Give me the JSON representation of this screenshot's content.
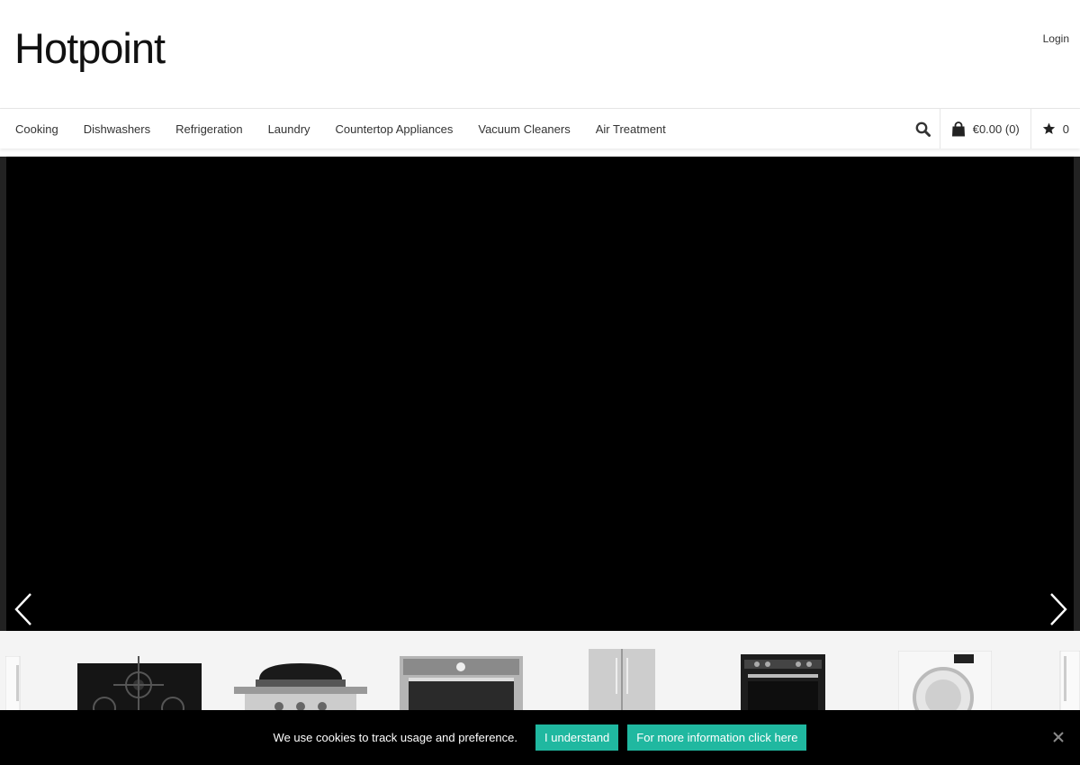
{
  "header": {
    "logo_text": "Hotpoint",
    "login_label": "Login"
  },
  "nav": {
    "items": [
      {
        "label": "Cooking"
      },
      {
        "label": "Dishwashers"
      },
      {
        "label": "Refrigeration"
      },
      {
        "label": "Laundry"
      },
      {
        "label": "Countertop Appliances"
      },
      {
        "label": "Vacuum Cleaners"
      },
      {
        "label": "Air Treatment"
      }
    ],
    "search_icon": "search-icon",
    "cart_icon": "shopping-bag-icon",
    "cart_label": "€0.00 (0)",
    "wishlist_icon": "star-icon",
    "wishlist_count": "0"
  },
  "slider": {
    "prev_icon": "chevron-left-icon",
    "next_icon": "chevron-right-icon"
  },
  "products": [
    {
      "icon": "fridge-partial-icon"
    },
    {
      "icon": "gas-hob-icon"
    },
    {
      "icon": "gas-barbecue-icon"
    },
    {
      "icon": "built-in-oven-icon"
    },
    {
      "icon": "side-by-side-fridge-icon"
    },
    {
      "icon": "electric-cooker-icon"
    },
    {
      "icon": "washing-machine-icon"
    },
    {
      "icon": "fridge-partial-icon"
    }
  ],
  "cookie": {
    "text": "We use cookies to track usage and preference.",
    "accept_label": "I understand",
    "info_label": "For more information click here",
    "close_icon": "close-icon"
  },
  "colors": {
    "accent": "#20b8a0",
    "hero_bg": "#000000",
    "cookie_bg": "#000000"
  }
}
